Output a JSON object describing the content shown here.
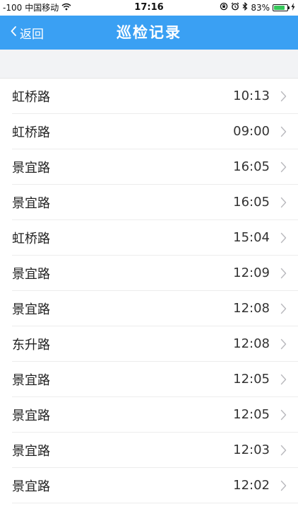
{
  "status_bar": {
    "signal": "-100",
    "carrier": "中国移动",
    "wifi_icon": "wifi-icon",
    "time": "17:16",
    "battery_percent": "83%",
    "battery_level": 0.83
  },
  "nav": {
    "back_label": "返回",
    "title": "巡检记录"
  },
  "records": [
    {
      "road": "虹桥路",
      "time": "10:13"
    },
    {
      "road": "虹桥路",
      "time": "09:00"
    },
    {
      "road": "景宜路",
      "time": "16:05"
    },
    {
      "road": "景宜路",
      "time": "16:05"
    },
    {
      "road": "虹桥路",
      "time": "15:04"
    },
    {
      "road": "景宜路",
      "time": "12:09"
    },
    {
      "road": "景宜路",
      "time": "12:08"
    },
    {
      "road": "东升路",
      "time": "12:08"
    },
    {
      "road": "景宜路",
      "time": "12:05"
    },
    {
      "road": "景宜路",
      "time": "12:05"
    },
    {
      "road": "景宜路",
      "time": "12:03"
    },
    {
      "road": "景宜路",
      "time": "12:02"
    }
  ],
  "colors": {
    "nav_background": "#3aa0f3",
    "battery": "#35c759"
  }
}
